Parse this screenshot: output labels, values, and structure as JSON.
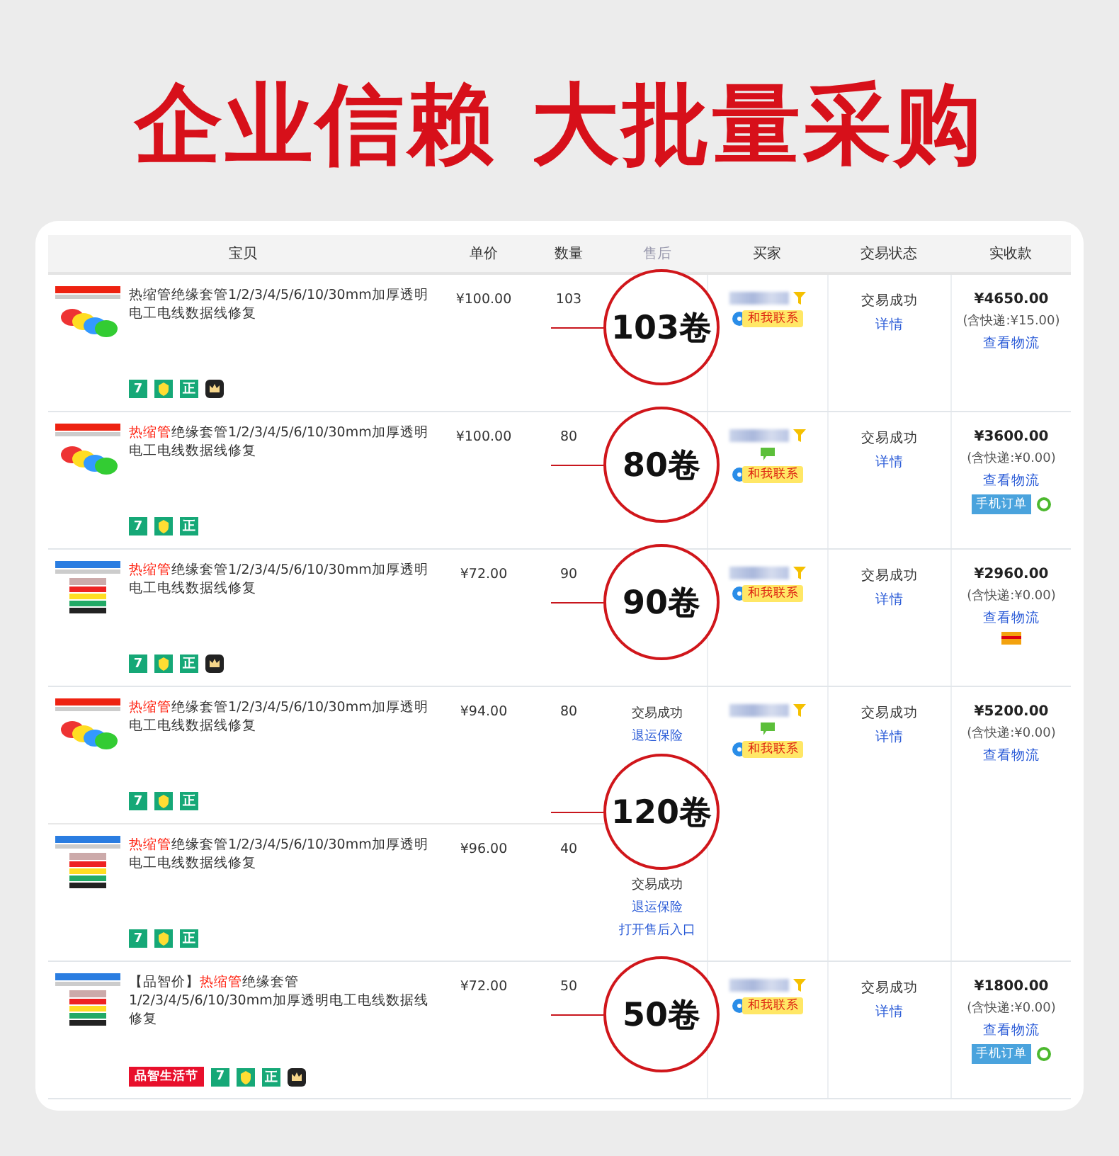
{
  "headline": "企业信赖 大批量采购",
  "table": {
    "columns": [
      "宝贝",
      "单价",
      "数量",
      "售后",
      "买家",
      "交易状态",
      "实收款"
    ],
    "orders": [
      {
        "callout": "103卷",
        "buyer": {
          "chat": false,
          "contact": "和我联系"
        },
        "status": "交易成功",
        "detail_link": "详情",
        "total": "¥4650.00",
        "shipping": "(含快递:¥15.00)",
        "logistics_link": "查看物流",
        "items": [
          {
            "title": [
              {
                "text": "热缩管绝缘套管1/2/3/4/5/6/10/30mm加厚透明电工电线数据线修复",
                "highlight": false
              }
            ],
            "price": "¥100.00",
            "quantity": "103",
            "badges": [
              {
                "kind": "seven",
                "text": "7"
              },
              {
                "kind": "shield"
              },
              {
                "kind": "zheng",
                "text": "正"
              },
              {
                "kind": "crown"
              }
            ]
          }
        ]
      },
      {
        "callout": "80卷",
        "buyer": {
          "chat": true,
          "contact": "和我联系"
        },
        "status": "交易成功",
        "detail_link": "详情",
        "total": "¥3600.00",
        "shipping": "(含快递:¥0.00)",
        "logistics_link": "查看物流",
        "extras": [
          {
            "kind": "mobile",
            "text": "手机订单"
          }
        ],
        "items": [
          {
            "title": [
              {
                "text": "热缩管",
                "highlight": true
              },
              {
                "text": "绝缘套管1/2/3/4/5/6/10/30mm加厚透明电工电线数据线修复",
                "highlight": false
              }
            ],
            "price": "¥100.00",
            "quantity": "80",
            "badges": [
              {
                "kind": "seven",
                "text": "7"
              },
              {
                "kind": "shield"
              },
              {
                "kind": "zheng",
                "text": "正"
              }
            ]
          }
        ]
      },
      {
        "callout": "90卷",
        "buyer": {
          "chat": false,
          "contact": "和我联系"
        },
        "status": "交易成功",
        "detail_link": "详情",
        "total": "¥2960.00",
        "shipping": "(含快递:¥0.00)",
        "logistics_link": "查看物流",
        "extras": [
          {
            "kind": "card"
          }
        ],
        "items": [
          {
            "title": [
              {
                "text": "热缩管",
                "highlight": true
              },
              {
                "text": "绝缘套管1/2/3/4/5/6/10/30mm加厚透明电工电线数据线修复",
                "highlight": false
              }
            ],
            "price": "¥72.00",
            "quantity": "90",
            "badges": [
              {
                "kind": "seven",
                "text": "7"
              },
              {
                "kind": "shield"
              },
              {
                "kind": "zheng",
                "text": "正"
              },
              {
                "kind": "crown"
              }
            ]
          }
        ]
      },
      {
        "callout": "120卷",
        "buyer": {
          "chat": true,
          "contact": "和我联系"
        },
        "status": "交易成功",
        "detail_link": "详情",
        "total": "¥5200.00",
        "shipping": "(含快递:¥0.00)",
        "logistics_link": "查看物流",
        "items": [
          {
            "title": [
              {
                "text": "热缩管",
                "highlight": true
              },
              {
                "text": "绝缘套管1/2/3/4/5/6/10/30mm加厚透明电工电线数据线修复",
                "highlight": false
              }
            ],
            "price": "¥94.00",
            "quantity": "80",
            "after_sale": [
              {
                "kind": "status",
                "text": "交易成功"
              },
              {
                "kind": "link",
                "text": "退运保险"
              }
            ],
            "badges": [
              {
                "kind": "seven",
                "text": "7"
              },
              {
                "kind": "shield"
              },
              {
                "kind": "zheng",
                "text": "正"
              }
            ]
          },
          {
            "title": [
              {
                "text": "热缩管",
                "highlight": true
              },
              {
                "text": "绝缘套管1/2/3/4/5/6/10/30mm加厚透明电工电线数据线修复",
                "highlight": false
              }
            ],
            "price": "¥96.00",
            "quantity": "40",
            "after_sale": [
              {
                "kind": "status",
                "text": "交易成功"
              },
              {
                "kind": "link",
                "text": "退运保险"
              },
              {
                "kind": "link",
                "text": "打开售后入口"
              }
            ],
            "badges": [
              {
                "kind": "seven",
                "text": "7"
              },
              {
                "kind": "shield"
              },
              {
                "kind": "zheng",
                "text": "正"
              }
            ]
          }
        ]
      },
      {
        "callout": "50卷",
        "buyer": {
          "chat": false,
          "contact": "和我联系"
        },
        "status": "交易成功",
        "detail_link": "详情",
        "total": "¥1800.00",
        "shipping": "(含快递:¥0.00)",
        "logistics_link": "查看物流",
        "extras": [
          {
            "kind": "mobile",
            "text": "手机订单"
          }
        ],
        "items": [
          {
            "title": [
              {
                "text": "【品智价】",
                "highlight": false
              },
              {
                "text": "热缩管",
                "highlight": true
              },
              {
                "text": "绝缘套管1/2/3/4/5/6/10/30mm加厚透明电工电线数据线修复",
                "highlight": false
              }
            ],
            "price": "¥72.00",
            "quantity": "50",
            "badges": [
              {
                "kind": "promo",
                "text": "品智生活节"
              },
              {
                "kind": "seven",
                "text": "7"
              },
              {
                "kind": "shield"
              },
              {
                "kind": "zheng",
                "text": "正"
              },
              {
                "kind": "crown"
              }
            ]
          }
        ]
      }
    ]
  }
}
